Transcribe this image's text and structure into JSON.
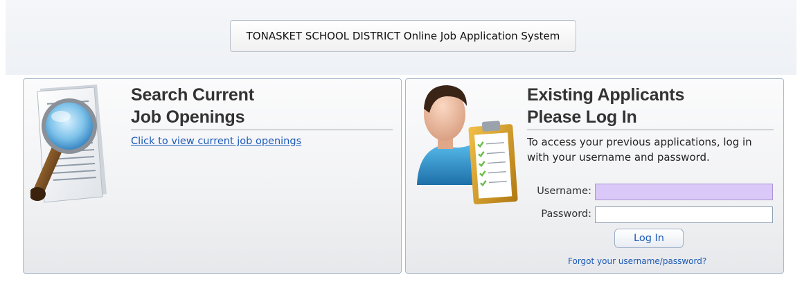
{
  "header": {
    "title": "TONASKET SCHOOL DISTRICT Online Job Application System"
  },
  "search_panel": {
    "heading_line1": "Search Current",
    "heading_line2": "Job Openings",
    "link_text": "Click to view current job openings",
    "icon": "magnifier-document-icon"
  },
  "login_panel": {
    "heading_line1": "Existing Applicants",
    "heading_line2": "Please Log In",
    "description_line1": "To access your previous applications, log in",
    "description_line2": "with your username and password.",
    "username_label": "Username:",
    "username_value": "",
    "password_label": "Password:",
    "password_value": "",
    "login_button": "Log In",
    "forgot_link": "Forgot your username/password?",
    "icon": "applicant-clipboard-icon"
  },
  "colors": {
    "link": "#1c5ab8",
    "username_field_bg": "#d9c8f8",
    "panel_border": "#a8b8cc"
  }
}
